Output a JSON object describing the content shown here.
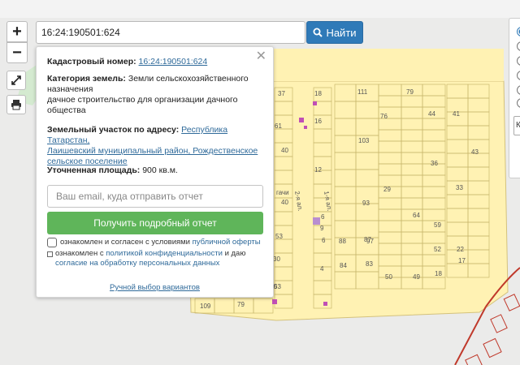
{
  "search": {
    "value": "16:24:190501:624",
    "button_label": "Найти"
  },
  "zoom": {
    "in_label": "+",
    "out_label": "−"
  },
  "info": {
    "cadastral_label": "Кадастровый номер:",
    "cadastral_value": "16:24:190501:624",
    "category_label": "Категория земель:",
    "category_line1": "Земли сельскохозяйственного",
    "category_line2": "назначения",
    "category_line3": "дачное строительство для организации дачного",
    "category_line4": "общества",
    "address_label": "Земельный участок по адресу:",
    "address_line1": "Республика Татарстан,",
    "address_line2": "Лаишевский муниципальный район, Рождественское",
    "address_line3": "сельское поселение",
    "area_label": "Уточненная площадь:",
    "area_value": "900 кв.м.",
    "email_placeholder": "Ваш email, куда отправить отчет",
    "report_button": "Получить подробный отчет",
    "consent1_text": "ознакомлен и согласен с условиями",
    "consent1_link": "публичной оферты",
    "consent2_line1_text": "ознакомлен с",
    "consent2_line1_link": "политикой конфиденциальности",
    "consent2_line1_tail": "и даю",
    "consent2_line2_link": "согласие на обработку персональных данных",
    "manual_link": "Ручной выбор вариантов"
  },
  "map": {
    "labels": [
      "37",
      "18",
      "16",
      "12",
      "61",
      "40",
      "6",
      "40",
      "111",
      "103",
      "93",
      "97",
      "79",
      "76",
      "44",
      "41",
      "43",
      "36",
      "33",
      "29",
      "64",
      "59",
      "53",
      "88",
      "87",
      "84",
      "83",
      "52",
      "50",
      "49",
      "18",
      "22",
      "17",
      "9",
      "6",
      "4",
      "30",
      "53",
      "60",
      "109",
      "79",
      "2-я ал.",
      "1-я ал.",
      "гачи"
    ]
  },
  "colors": {
    "accent": "#2f7ab8",
    "green": "#5fb55a",
    "parcel_fill": "#fff2b3",
    "parcel_stroke": "#c9b86e",
    "boundary": "#c0392b",
    "marker": "#c04fb5"
  },
  "right_panel": {
    "dropdown_value": "К"
  }
}
